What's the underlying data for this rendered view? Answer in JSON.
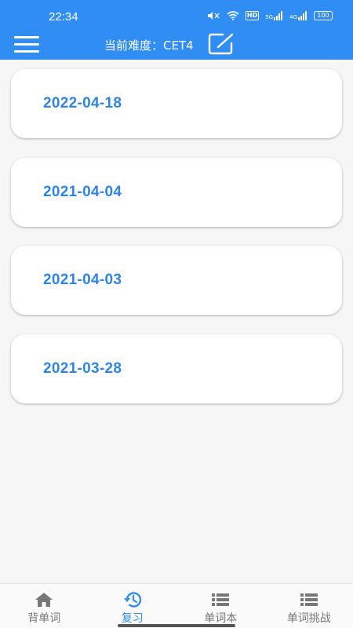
{
  "status_bar": {
    "time": "22:34",
    "icons": [
      "sound-off-icon",
      "wifi-icon",
      "hd-icon",
      "signal-5g-icon",
      "signal-4g-icon",
      "battery-icon"
    ],
    "hd_label": "HD",
    "sig1_label": "5G",
    "sig2_label": "4G",
    "battery_level": "100"
  },
  "header": {
    "menu_icon": "menu-icon",
    "difficulty_label": "当前难度：CET4",
    "edit_icon": "edit-icon"
  },
  "review_dates": [
    {
      "date": "2022-04-18"
    },
    {
      "date": "2021-04-04"
    },
    {
      "date": "2021-04-03"
    },
    {
      "date": "2021-03-28"
    }
  ],
  "bottom_nav": {
    "items": [
      {
        "label": "背单词",
        "icon": "home-icon",
        "active": false
      },
      {
        "label": "复习",
        "icon": "history-icon",
        "active": true
      },
      {
        "label": "单词本",
        "icon": "list-icon",
        "active": false
      },
      {
        "label": "单词挑战",
        "icon": "list-icon",
        "active": false
      }
    ]
  },
  "colors": {
    "primary": "#2f8df3",
    "date_text": "#2f85e6",
    "inactive": "#777777"
  }
}
